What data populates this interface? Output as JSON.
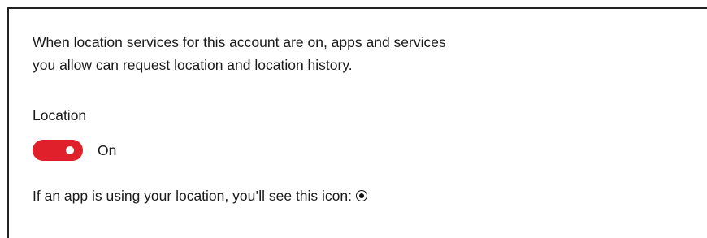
{
  "description": {
    "line1": "When location services for this account are on, apps and services",
    "line2": "you allow can request location and location history."
  },
  "location": {
    "label": "Location",
    "toggle_state": "On",
    "toggle_on": true,
    "accent_color": "#e0202a"
  },
  "info": {
    "text": "If an app is using your location, you’ll see this icon:",
    "icon": "location-in-use-icon"
  }
}
